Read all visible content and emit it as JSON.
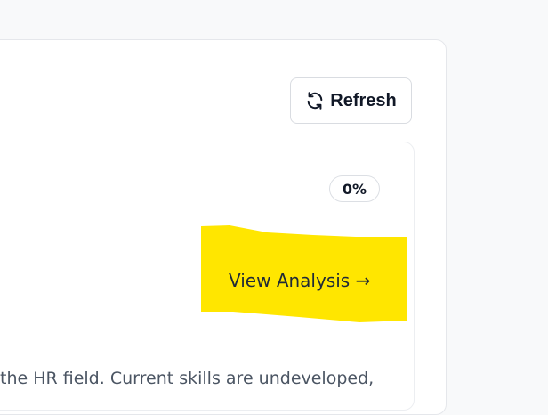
{
  "toolbar": {
    "refresh_label": "Refresh",
    "refresh_icon": "refresh-icon"
  },
  "card": {
    "progress_label": "0%",
    "progress_value": 0,
    "view_analysis_label": "View Analysis →",
    "description": "the HR field. Current skills are undeveloped,"
  },
  "colors": {
    "highlight": "#ffe600",
    "text_dark": "#111827",
    "text_muted": "#4b5563",
    "border": "#e5e7eb"
  }
}
